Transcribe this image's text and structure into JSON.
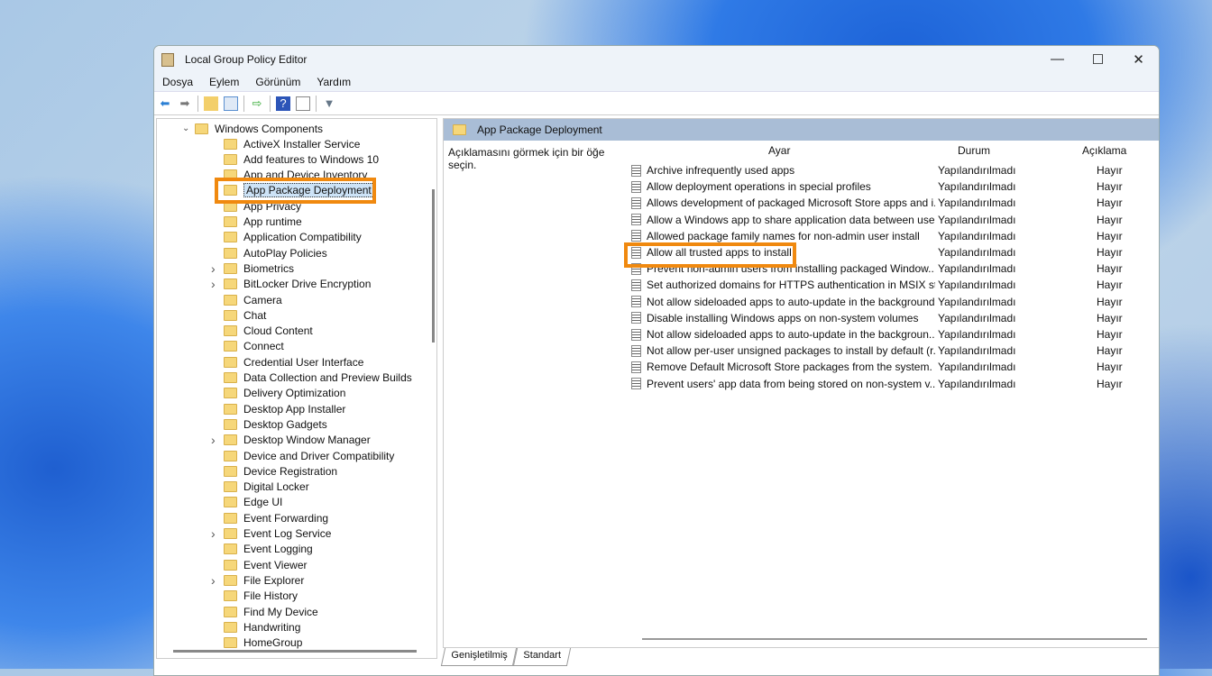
{
  "window": {
    "title": "Local Group Policy Editor",
    "controls": [
      "—",
      "☐",
      "✕"
    ]
  },
  "menu": [
    "Dosya",
    "Eylem",
    "Görünüm",
    "Yardım"
  ],
  "tree": {
    "root": "Windows Components",
    "items": [
      {
        "label": "ActiveX Installer Service",
        "expandable": false
      },
      {
        "label": "Add features to Windows 10",
        "expandable": false
      },
      {
        "label": "App and Device Inventory",
        "expandable": false
      },
      {
        "label": "App Package Deployment",
        "expandable": false,
        "selected": true
      },
      {
        "label": "App Privacy",
        "expandable": false
      },
      {
        "label": "App runtime",
        "expandable": false
      },
      {
        "label": "Application Compatibility",
        "expandable": false
      },
      {
        "label": "AutoPlay Policies",
        "expandable": false
      },
      {
        "label": "Biometrics",
        "expandable": true
      },
      {
        "label": "BitLocker Drive Encryption",
        "expandable": true
      },
      {
        "label": "Camera",
        "expandable": false
      },
      {
        "label": "Chat",
        "expandable": false
      },
      {
        "label": "Cloud Content",
        "expandable": false
      },
      {
        "label": "Connect",
        "expandable": false
      },
      {
        "label": "Credential User Interface",
        "expandable": false
      },
      {
        "label": "Data Collection and Preview Builds",
        "expandable": false
      },
      {
        "label": "Delivery Optimization",
        "expandable": false
      },
      {
        "label": "Desktop App Installer",
        "expandable": false
      },
      {
        "label": "Desktop Gadgets",
        "expandable": false
      },
      {
        "label": "Desktop Window Manager",
        "expandable": true
      },
      {
        "label": "Device and Driver Compatibility",
        "expandable": false
      },
      {
        "label": "Device Registration",
        "expandable": false
      },
      {
        "label": "Digital Locker",
        "expandable": false
      },
      {
        "label": "Edge UI",
        "expandable": false
      },
      {
        "label": "Event Forwarding",
        "expandable": false
      },
      {
        "label": "Event Log Service",
        "expandable": true
      },
      {
        "label": "Event Logging",
        "expandable": false
      },
      {
        "label": "Event Viewer",
        "expandable": false
      },
      {
        "label": "File Explorer",
        "expandable": true
      },
      {
        "label": "File History",
        "expandable": false
      },
      {
        "label": "Find My Device",
        "expandable": false
      },
      {
        "label": "Handwriting",
        "expandable": false
      },
      {
        "label": "HomeGroup",
        "expandable": false
      }
    ]
  },
  "panel": {
    "title": "App Package Deployment",
    "description": "Açıklamasını görmek için bir öğe seçin.",
    "columns": [
      "Ayar",
      "Durum",
      "Açıklama"
    ],
    "rows": [
      [
        "Archive infrequently used apps",
        "Yapılandırılmadı",
        "Hayır"
      ],
      [
        "Allow deployment operations in special profiles",
        "Yapılandırılmadı",
        "Hayır"
      ],
      [
        "Allows development of packaged Microsoft Store apps and i...",
        "Yapılandırılmadı",
        "Hayır"
      ],
      [
        "Allow a Windows app to share application data between users",
        "Yapılandırılmadı",
        "Hayır"
      ],
      [
        "Allowed package family names for non-admin user install",
        "Yapılandırılmadı",
        "Hayır"
      ],
      [
        "Allow all trusted apps to install",
        "Yapılandırılmadı",
        "Hayır"
      ],
      [
        "Prevent non-admin users from installing packaged Window...",
        "Yapılandırılmadı",
        "Hayır"
      ],
      [
        "Set authorized domains for HTTPS authentication in MSIX st...",
        "Yapılandırılmadı",
        "Hayır"
      ],
      [
        "Not allow sideloaded apps to auto-update in the background",
        "Yapılandırılmadı",
        "Hayır"
      ],
      [
        "Disable installing Windows apps on non-system volumes",
        "Yapılandırılmadı",
        "Hayır"
      ],
      [
        "Not allow sideloaded apps to auto-update in the backgroun...",
        "Yapılandırılmadı",
        "Hayır"
      ],
      [
        "Not allow per-user unsigned packages to install by default (r...",
        "Yapılandırılmadı",
        "Hayır"
      ],
      [
        "Remove Default Microsoft Store packages from the system.",
        "Yapılandırılmadı",
        "Hayır"
      ],
      [
        "Prevent users' app data from being stored on non-system v...",
        "Yapılandırılmadı",
        "Hayır"
      ]
    ]
  },
  "tabs": [
    "Genişletilmiş",
    "Standart"
  ],
  "highlight_color": "#f0890f"
}
